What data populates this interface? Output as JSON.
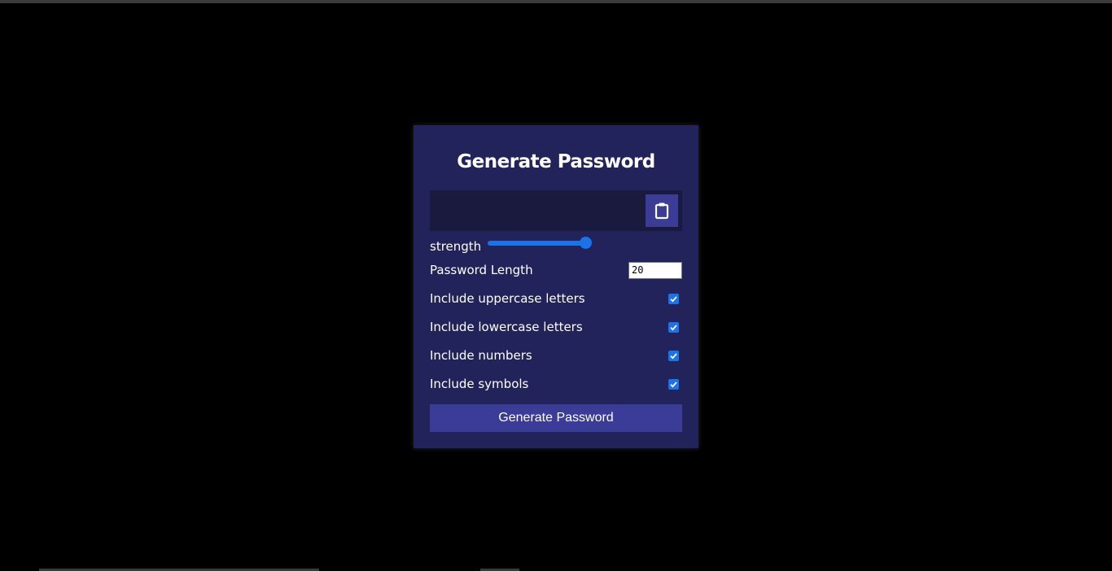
{
  "card": {
    "title": "Generate Password",
    "result": "",
    "strength_label": "strength",
    "strength_level": 1.0,
    "settings": {
      "length_label": "Password Length",
      "length_value": "20",
      "uppercase_label": "Include uppercase letters",
      "uppercase_checked": true,
      "lowercase_label": "Include lowercase letters",
      "lowercase_checked": true,
      "numbers_label": "Include numbers",
      "numbers_checked": true,
      "symbols_label": "Include symbols",
      "symbols_checked": true
    },
    "generate_label": "Generate Password"
  },
  "icons": {
    "clipboard": "clipboard-icon",
    "check": "checkmark-icon"
  },
  "colors": {
    "background": "#000000",
    "card": "#23235b",
    "result_box": "#1a1a3e",
    "button": "#3b3b98",
    "accent": "#1a73e8",
    "text": "#ffffff"
  }
}
